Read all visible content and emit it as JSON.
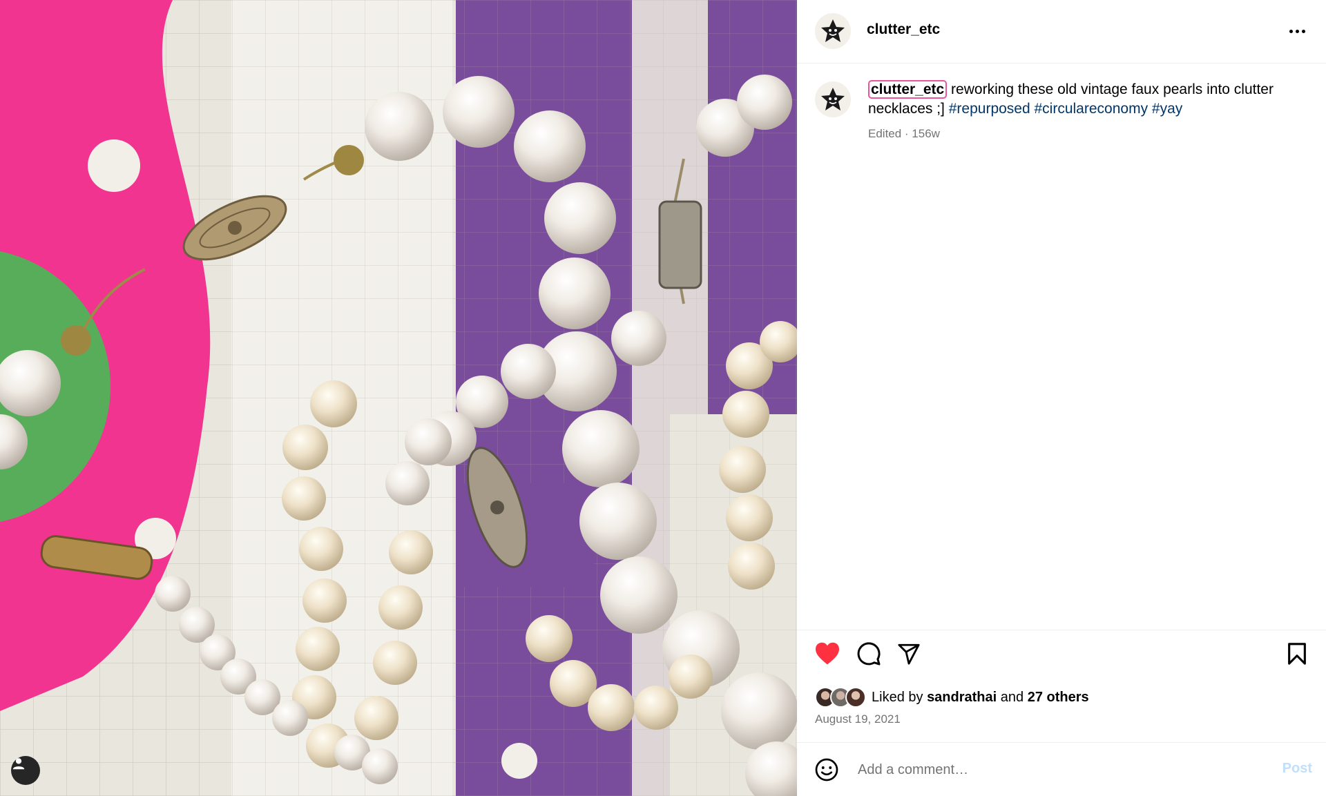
{
  "post": {
    "username": "clutter_etc",
    "caption_username": "clutter_etc",
    "caption_text": " reworking these old vintage faux pearls into clutter necklaces ;] ",
    "hashtags": [
      "#repurposed",
      "#circulareconomy",
      "#yay"
    ],
    "caption_meta": "Edited · 156w",
    "likes_prefix": "Liked by ",
    "liked_by_user": "sandrathai",
    "likes_and": " and ",
    "likes_others": "27 others",
    "date": "August 19, 2021"
  },
  "comment": {
    "placeholder": "Add a comment…",
    "post_label": "Post"
  },
  "icons": {
    "header_options": "more-horizontal-icon",
    "like": "heart-filled-icon",
    "comment": "comment-bubble-icon",
    "share": "paper-plane-icon",
    "save": "bookmark-icon",
    "emoji": "smiley-icon",
    "tagged_users": "user-silhouette-icon"
  },
  "colors": {
    "like_red": "#ff3040",
    "hashtag_blue": "#00376b",
    "post_button_disabled": "#c0dffd",
    "meta_gray": "#737373"
  }
}
